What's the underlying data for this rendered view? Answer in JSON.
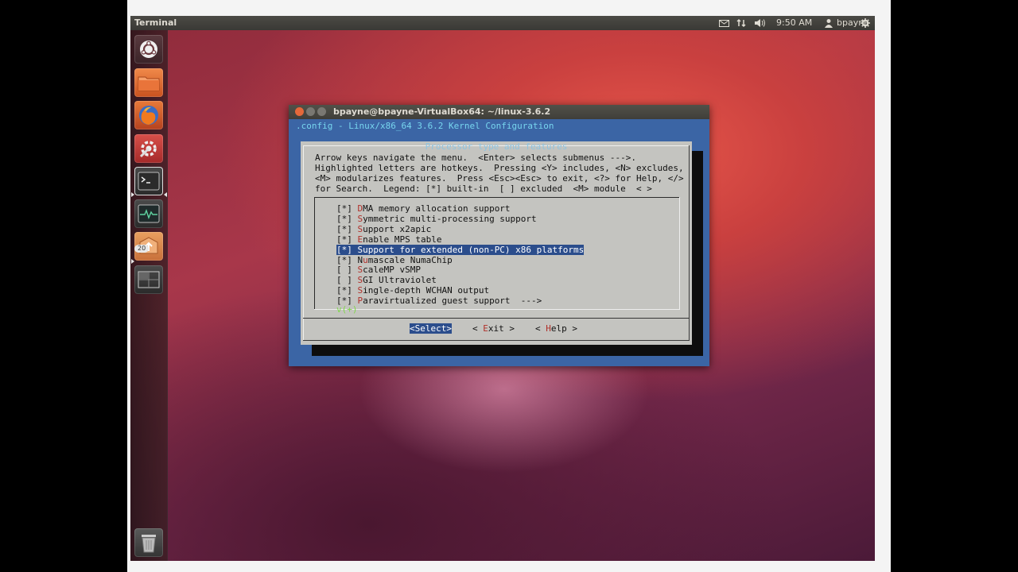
{
  "panel": {
    "app_title": "Terminal",
    "clock": "9:50 AM",
    "user": "bpayne"
  },
  "launcher": {
    "badge_count": "20",
    "items": [
      {
        "name": "dash-home"
      },
      {
        "name": "files"
      },
      {
        "name": "firefox"
      },
      {
        "name": "system-settings"
      },
      {
        "name": "terminal"
      },
      {
        "name": "system-monitor"
      },
      {
        "name": "update-manager"
      },
      {
        "name": "workspace-switcher"
      },
      {
        "name": "trash"
      }
    ]
  },
  "window": {
    "title": "bpayne@bpayne-VirtualBox64: ~/linux-3.6.2",
    "header": ".config - Linux/x86_64 3.6.2 Kernel Configuration",
    "dialog": {
      "title": "Processor type and features",
      "help": [
        "Arrow keys navigate the menu.  <Enter> selects submenus --->.",
        "Highlighted letters are hotkeys.  Pressing <Y> includes, <N> excludes,",
        "<M> modularizes features.  Press <Esc><Esc> to exit, <?> for Help, </>",
        "for Search.  Legend: [*] built-in  [ ] excluded  <M> module  < >"
      ],
      "items": [
        {
          "state": "[*]",
          "hotkey": "D",
          "rest": "MA memory allocation support"
        },
        {
          "state": "[*]",
          "hotkey": "S",
          "rest": "ymmetric multi-processing support"
        },
        {
          "state": "[*]",
          "hotkey": "S",
          "rest": "upport x2apic"
        },
        {
          "state": "[*]",
          "hotkey": "E",
          "rest": "nable MPS table"
        },
        {
          "state": "[*]",
          "hotkey": "S",
          "rest": "upport for extended (non-PC) x86 platforms"
        },
        {
          "state": "[*]",
          "hotkey": "N",
          "rest": "umascale NumaChip",
          "hotkey_pos": 1
        },
        {
          "state": "[ ]",
          "hotkey": "S",
          "rest": "caleMP vSMP"
        },
        {
          "state": "[ ]",
          "hotkey": "S",
          "rest": "GI Ultraviolet"
        },
        {
          "state": "[*]",
          "hotkey": "S",
          "rest": "ingle-depth WCHAN output"
        },
        {
          "state": "[*]",
          "hotkey": "P",
          "rest": "aravirtualized guest support  --->"
        }
      ],
      "selected_index": 4,
      "more_indicator": "v(+)",
      "buttons": {
        "select": "<Select>",
        "exit_pre": "< ",
        "exit_hk": "E",
        "exit_rest": "xit >",
        "help_pre": "< ",
        "help_hk": "H",
        "help_rest": "elp >"
      }
    }
  },
  "colors": {
    "selection": "#2b4d8c",
    "hotkey": "#b0302a",
    "dialog_bg": "#c4c4c0",
    "window_bg": "#3b65a5"
  }
}
